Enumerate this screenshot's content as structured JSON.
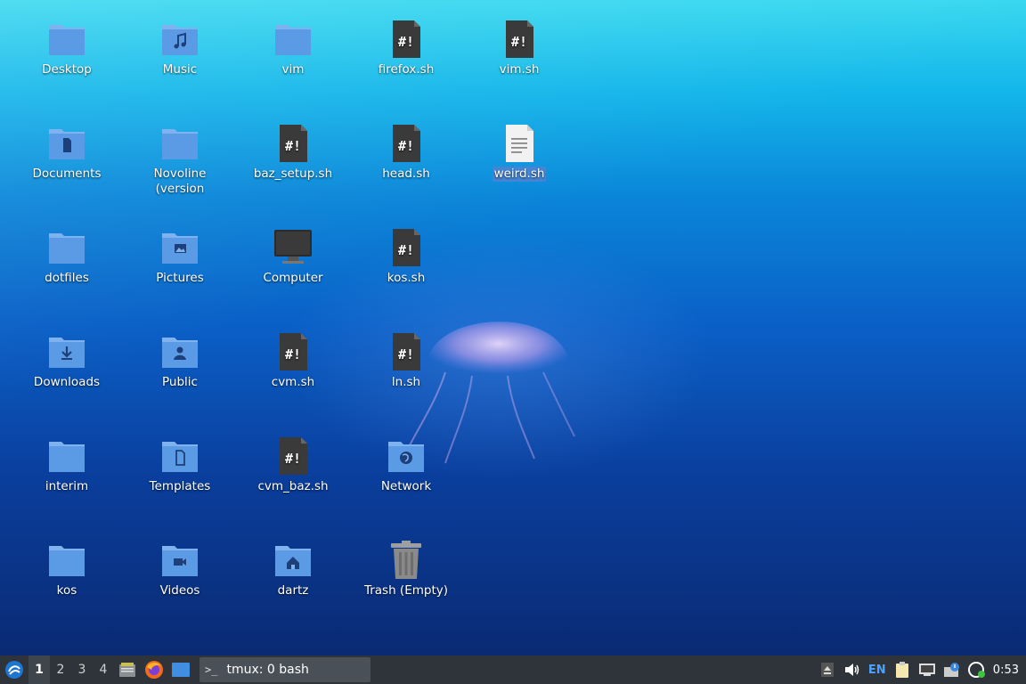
{
  "desktop": {
    "icons": [
      {
        "label": "Desktop",
        "type": "folder"
      },
      {
        "label": "Music",
        "type": "folder-music"
      },
      {
        "label": "vim",
        "type": "folder"
      },
      {
        "label": "firefox.sh",
        "type": "script"
      },
      {
        "label": "vim.sh",
        "type": "script"
      },
      {
        "label": "Documents",
        "type": "folder-documents"
      },
      {
        "label": "Novoline (version",
        "type": "folder"
      },
      {
        "label": "baz_setup.sh",
        "type": "script"
      },
      {
        "label": "head.sh",
        "type": "script"
      },
      {
        "label": "weird.sh",
        "type": "text-file",
        "selected": true
      },
      {
        "label": "dotfiles",
        "type": "folder"
      },
      {
        "label": "Pictures",
        "type": "folder-pictures"
      },
      {
        "label": "Computer",
        "type": "computer"
      },
      {
        "label": "kos.sh",
        "type": "script"
      },
      {
        "label": "Downloads",
        "type": "folder-downloads"
      },
      {
        "label": "Public",
        "type": "folder-public"
      },
      {
        "label": "cvm.sh",
        "type": "script"
      },
      {
        "label": "ln.sh",
        "type": "script"
      },
      {
        "label": "interim",
        "type": "folder"
      },
      {
        "label": "Templates",
        "type": "folder-templates"
      },
      {
        "label": "cvm_baz.sh",
        "type": "script"
      },
      {
        "label": "Network",
        "type": "folder-network"
      },
      {
        "label": "kos",
        "type": "folder"
      },
      {
        "label": "Videos",
        "type": "folder-videos"
      },
      {
        "label": "dartz",
        "type": "folder-home"
      },
      {
        "label": "Trash (Empty)",
        "type": "trash"
      }
    ]
  },
  "taskbar": {
    "workspaces": [
      "1",
      "2",
      "3",
      "4"
    ],
    "active_workspace": "1",
    "launchers": [
      "file-manager-icon",
      "firefox-icon",
      "show-desktop-icon"
    ],
    "task": {
      "label": "tmux: 0 bash",
      "prompt": ">_"
    },
    "tray": {
      "language": "EN",
      "clock": "0:53"
    }
  },
  "colors": {
    "folder": "#5b9be6",
    "folder_tab": "#7fb3f0",
    "script_file": "#3a3a3a",
    "taskbar_bg": "#2f343b",
    "selection": "#5082d2"
  }
}
